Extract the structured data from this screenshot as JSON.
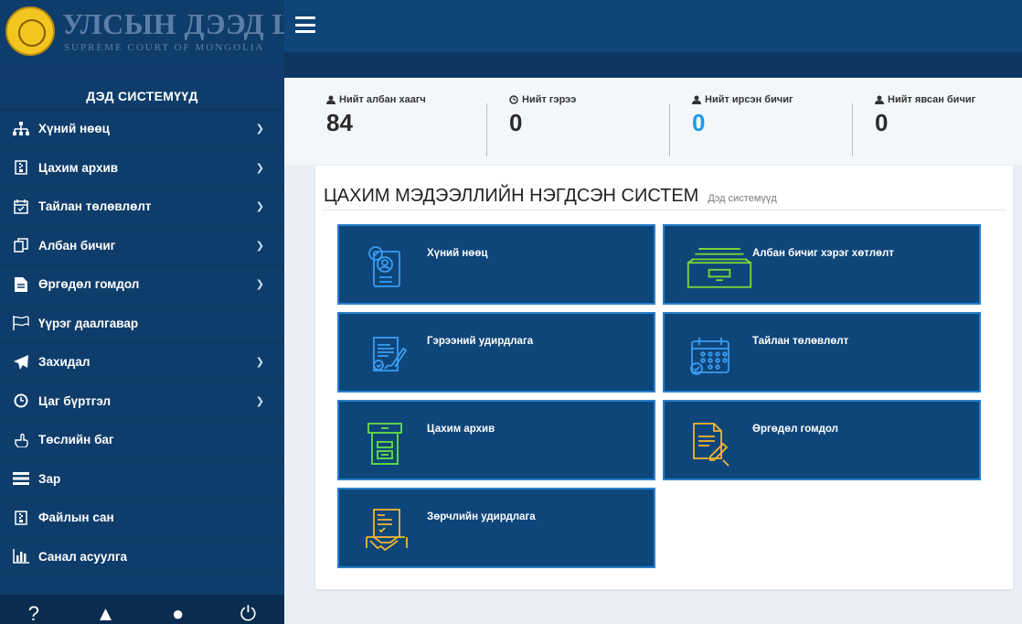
{
  "brand": {
    "title": "УЛСЫН ДЭЭД ШҮҮХ",
    "subtitle": "SUPREME COURT OF MONGOLIA"
  },
  "sidebar": {
    "header": "ДЭД СИСТЕМҮҮД",
    "items": [
      {
        "label": "Хүний нөөц",
        "icon": "sitemap-icon",
        "chevron": true
      },
      {
        "label": "Цахим архив",
        "icon": "file-archive-icon",
        "chevron": true
      },
      {
        "label": "Тайлан төлөвлөлт",
        "icon": "calendar-check-icon",
        "chevron": true
      },
      {
        "label": "Албан бичиг",
        "icon": "copy-icon",
        "chevron": true
      },
      {
        "label": "Өргөдөл гомдол",
        "icon": "file-text-icon",
        "chevron": true
      },
      {
        "label": "Үүрэг даалгавар",
        "icon": "flag-icon",
        "chevron": false
      },
      {
        "label": "Захидал",
        "icon": "paper-plane-icon",
        "chevron": true
      },
      {
        "label": "Цаг бүртгэл",
        "icon": "clock-icon",
        "chevron": true
      },
      {
        "label": "Төслийн баг",
        "icon": "hand-point-icon",
        "chevron": false
      },
      {
        "label": "Зар",
        "icon": "list-icon",
        "chevron": false
      },
      {
        "label": "Файлын сан",
        "icon": "file-icon",
        "chevron": false
      },
      {
        "label": "Санал асуулга",
        "icon": "bar-chart-icon",
        "chevron": false
      }
    ]
  },
  "stats": [
    {
      "label": "Нийт албан хаагч",
      "icon": "user-icon",
      "value": "84",
      "color": "#2b2b2b"
    },
    {
      "label": "Нийт гэрээ",
      "icon": "clock-icon",
      "value": "0",
      "color": "#2b2b2b"
    },
    {
      "label": "Нийт ирсэн бичиг",
      "icon": "user-icon",
      "value": "0",
      "color": "#1a9be8"
    },
    {
      "label": "Нийт явсан бичиг",
      "icon": "user-icon",
      "value": "0",
      "color": "#2b2b2b"
    }
  ],
  "panel": {
    "title": "ЦАХИМ МЭДЭЭЛЛИЙН НЭГДСЭН СИСТЕМ",
    "subtitle": "Дэд системүүд"
  },
  "tiles": [
    {
      "label": "Хүний нөөц",
      "icon": "profile-doc-icon",
      "color": "#3b9cf0"
    },
    {
      "label": "Албан бичиг хэрэг хөтлөлт",
      "icon": "archive-drawer-icon",
      "color": "#7bd13a"
    },
    {
      "label": "Гэрээний удирдлага",
      "icon": "contract-sign-icon",
      "color": "#3b9cf0"
    },
    {
      "label": "Тайлан төлөвлөлт",
      "icon": "calendar-icon",
      "color": "#3b9cf0"
    },
    {
      "label": "Цахим архив",
      "icon": "archive-box-icon",
      "color": "#5ed14a"
    },
    {
      "label": "Өргөдөл гомдол",
      "icon": "doc-pen-icon",
      "color": "#f2b632"
    },
    {
      "label": "Зөрчлийн удирдлага",
      "icon": "handshake-doc-icon",
      "color": "#f2b632"
    }
  ]
}
